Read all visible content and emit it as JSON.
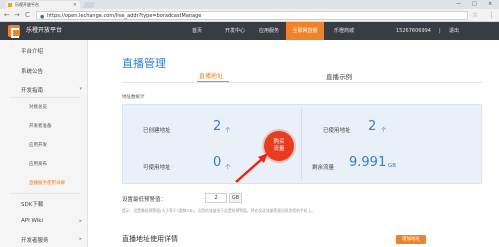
{
  "browser": {
    "tab_title": "乐视开放平台",
    "tab_close": "×",
    "url": "https://open.lechange.com/live_addr?type=boradcastManage",
    "back": "←",
    "forward": "→",
    "reload": "C",
    "star": "☆",
    "menu": "⋮",
    "window_controls": {
      "minimize": "—",
      "maximize": "□",
      "close": "×"
    }
  },
  "header": {
    "brand": "乐橙开放平台",
    "nav": [
      {
        "label": "首页",
        "active": false
      },
      {
        "label": "开发中心",
        "active": false
      },
      {
        "label": "应用服务",
        "active": false
      },
      {
        "label": "互联网直播",
        "active": true
      },
      {
        "label": "乐橙商城",
        "active": false
      }
    ],
    "phone": "15267606994",
    "divider": "|",
    "logout": "退出"
  },
  "sidebar": {
    "items": [
      {
        "label": "平台介绍",
        "type": "item"
      },
      {
        "label": "系统公告",
        "type": "item"
      },
      {
        "label": "开发指南",
        "type": "group",
        "caret": "▾"
      },
      {
        "label": "对接总览",
        "type": "sub"
      },
      {
        "label": "开发者准备",
        "type": "sub"
      },
      {
        "label": "应用开发",
        "type": "sub"
      },
      {
        "label": "应用发布",
        "type": "sub"
      },
      {
        "label": "直播服务使用详解",
        "type": "sub"
      },
      {
        "label": "SDK下载",
        "type": "item"
      },
      {
        "label": "API Wiki",
        "type": "group",
        "caret": "▸"
      },
      {
        "label": "开发者服务",
        "type": "group",
        "caret": "▸"
      }
    ]
  },
  "main": {
    "title": "直播管理",
    "tabs": [
      {
        "label": "直播地址",
        "active": true
      },
      {
        "label": "直播示例",
        "active": false
      }
    ],
    "stats_section_label": "地址数统计",
    "stats": {
      "created_label": "已创建地址",
      "created_value": "2",
      "created_unit": "个",
      "used_label": "已使用地址",
      "used_value": "2",
      "used_unit": "个",
      "available_label": "可使用地址",
      "available_value": "0",
      "available_unit": "个",
      "remaining_label": "剩余流量",
      "remaining_value": "9.991",
      "remaining_unit": "GB"
    },
    "buy_button": {
      "line1": "购买",
      "line2": "流量"
    },
    "warning": {
      "label": "设置最低预警值：",
      "value": "2",
      "unit": "GB",
      "hint": "提示：设置最低预警值(大于等于1整数GB)，当您的流量低于设置的预警值，将会发送流量警报消息到您的手机上。"
    },
    "usage_title": "直播地址使用详情",
    "add_button": "增加地址"
  },
  "colors": {
    "accent": "#f08228",
    "blue": "#2f7fd1",
    "header_bg": "#3a3c44",
    "buy_red": "#ea3b1f",
    "stats_bg": "#e9f0f8"
  }
}
